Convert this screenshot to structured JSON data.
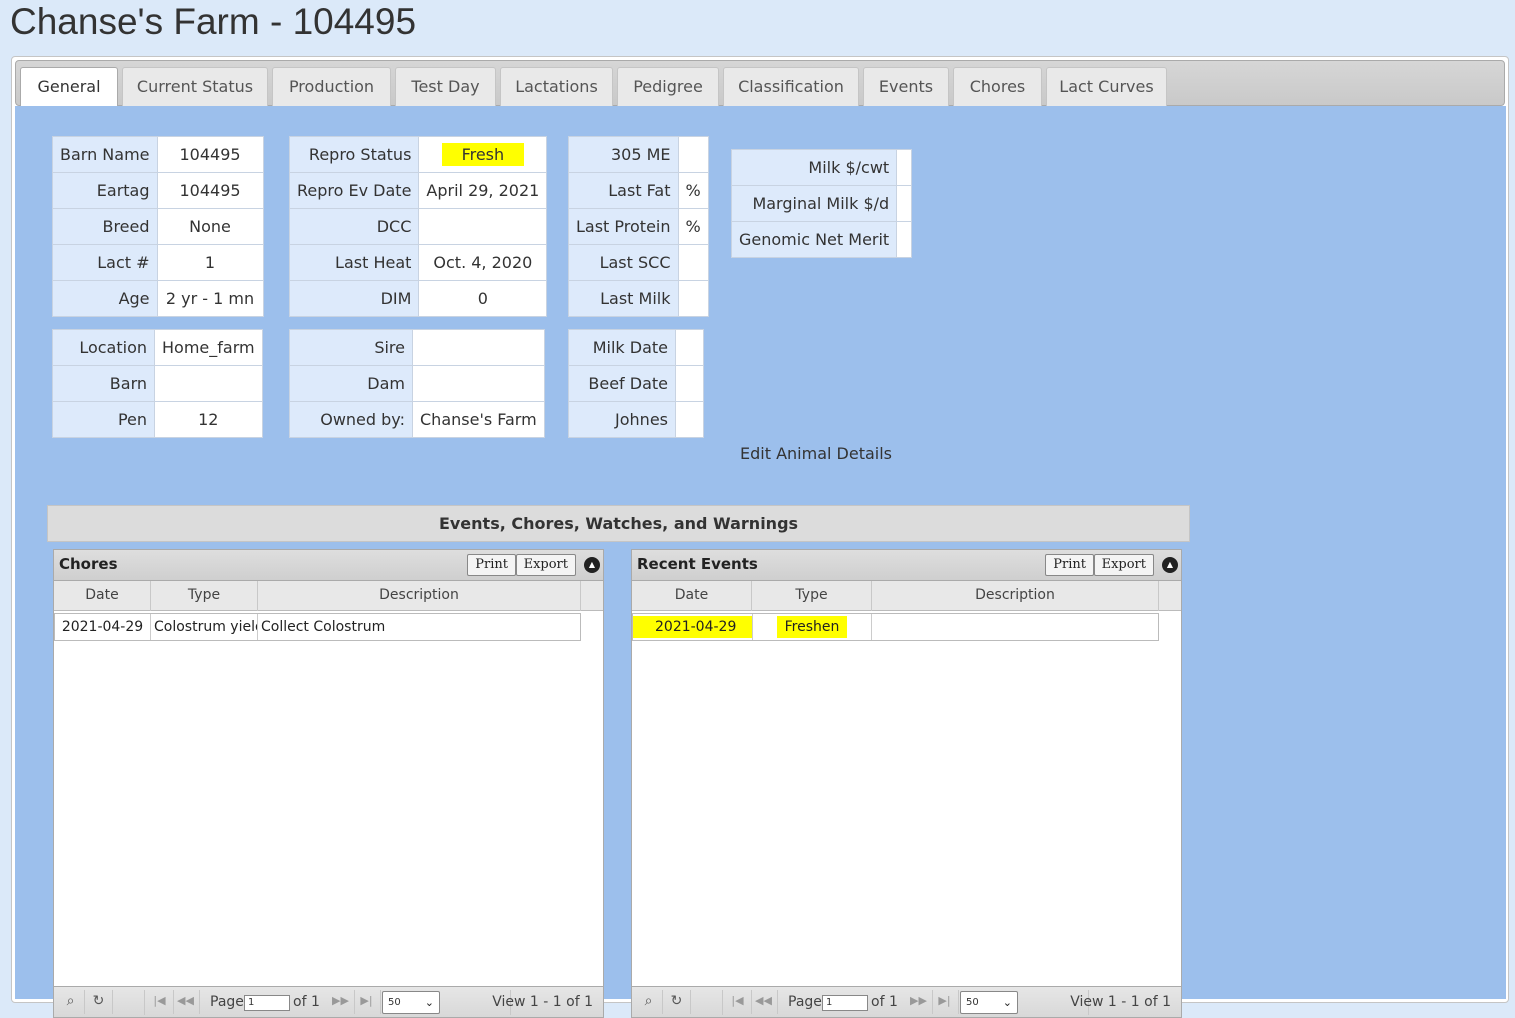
{
  "page": {
    "title": "Chanse's Farm - 104495"
  },
  "tabs": [
    "General",
    "Current Status",
    "Production",
    "Test Day",
    "Lactations",
    "Pedigree",
    "Classification",
    "Events",
    "Chores",
    "Lact Curves"
  ],
  "active_tab": "General",
  "animal": {
    "block1": [
      {
        "label": "Barn Name",
        "value": "104495"
      },
      {
        "label": "Eartag",
        "value": "104495"
      },
      {
        "label": "Breed",
        "value": "None"
      },
      {
        "label": "Lact #",
        "value": "1"
      },
      {
        "label": "Age",
        "value": "2 yr - 1 mn"
      }
    ],
    "block2": [
      {
        "label": "Repro Status",
        "value": "Fresh"
      },
      {
        "label": "Repro Ev Date",
        "value": "April 29, 2021"
      },
      {
        "label": "DCC",
        "value": ""
      },
      {
        "label": "Last Heat",
        "value": "Oct. 4, 2020"
      },
      {
        "label": "DIM",
        "value": "0"
      }
    ],
    "block3": [
      {
        "label": "305 ME",
        "value": ""
      },
      {
        "label": "Last Fat",
        "value": "%"
      },
      {
        "label": "Last Protein",
        "value": "%"
      },
      {
        "label": "Last SCC",
        "value": ""
      },
      {
        "label": "Last Milk",
        "value": ""
      }
    ],
    "block4": [
      {
        "label": "Milk $/cwt",
        "value": ""
      },
      {
        "label": "Marginal Milk $/d",
        "value": ""
      },
      {
        "label": "Genomic Net Merit",
        "value": ""
      }
    ],
    "block5": [
      {
        "label": "Location",
        "value": "Home_farm"
      },
      {
        "label": "Barn",
        "value": ""
      },
      {
        "label": "Pen",
        "value": "12"
      }
    ],
    "block6": [
      {
        "label": "Sire",
        "value": ""
      },
      {
        "label": "Dam",
        "value": ""
      },
      {
        "label": "Owned by:",
        "value": "Chanse's Farm"
      }
    ],
    "block7": [
      {
        "label": "Milk Date",
        "value": ""
      },
      {
        "label": "Beef Date",
        "value": ""
      },
      {
        "label": "Johnes",
        "value": ""
      }
    ],
    "highlight_color": "#ffff00"
  },
  "edit_link": "Edit Animal Details",
  "section_title": "Events, Chores, Watches, and Warnings",
  "chores": {
    "title": "Chores",
    "print": "Print",
    "export": "Export",
    "columns": [
      "Date",
      "Type",
      "Description"
    ],
    "rows": [
      {
        "date": "2021-04-29",
        "type": "Colostrum yield",
        "description": "Collect Colostrum"
      }
    ],
    "pager": {
      "page_label": "Page",
      "page_value": "1",
      "of_label": "of 1",
      "rows_per_page": "50",
      "view_text": "View 1 - 1 of 1"
    }
  },
  "events": {
    "title": "Recent Events",
    "print": "Print",
    "export": "Export",
    "columns": [
      "Date",
      "Type",
      "Description"
    ],
    "rows": [
      {
        "date": "2021-04-29",
        "type": "Freshen",
        "description": ""
      }
    ],
    "pager": {
      "page_label": "Page",
      "page_value": "1",
      "of_label": "of 1",
      "rows_per_page": "50",
      "view_text": "View 1 - 1 of 1"
    }
  },
  "colors": {
    "page_bg": "#dbe9f9",
    "panel_bg": "#9cbfec",
    "label_cell_bg": "#ddeafb",
    "highlight": "#ffff00"
  },
  "icons": [
    "search-icon",
    "refresh-icon",
    "first-page-icon",
    "prev-page-icon",
    "next-page-icon",
    "last-page-icon",
    "collapse-icon",
    "chevron-down-icon",
    "resize-grip-icon"
  ]
}
